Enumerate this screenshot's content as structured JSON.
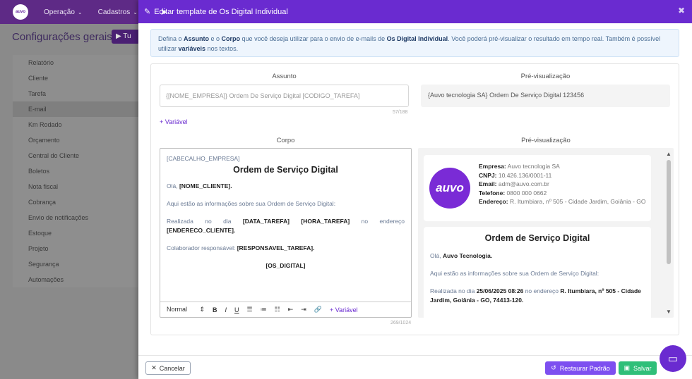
{
  "bg": {
    "nav": [
      "Operação",
      "Cadastros"
    ],
    "page_title": "Configurações gerais",
    "yt_button": "Tu",
    "sidebar": [
      "Relatório",
      "Cliente",
      "Tarefa",
      "E-mail",
      "Km Rodado",
      "Orçamento",
      "Central do Cliente",
      "Boletos",
      "Nota fiscal",
      "Cobrança",
      "Envio de notificações",
      "Estoque",
      "Projeto",
      "Segurança",
      "Automações"
    ]
  },
  "modal": {
    "title": "Editar template de Os Digital Individual",
    "info": {
      "p1": "Defina o ",
      "assunto": "Assunto",
      "p2": " e o ",
      "corpo": "Corpo",
      "p3": " que você deseja utilizar para o envio de e-mails de ",
      "osdigital": "Os Digital Individual",
      "p4": ". Você poderá pré-visualizar o resultado em tempo real. Também é possível utilizar ",
      "variaveis": "variáveis",
      "p5": " nos textos."
    },
    "subject": {
      "label": "Assunto",
      "value": "{[NOME_EMPRESA]} Ordem De Serviço Digital [CODIGO_TAREFA]",
      "counter": "57/188",
      "add_variable": "+ Variável",
      "preview_label": "Pré-visualização",
      "preview_value": "{Auvo tecnologia SA} Ordem De Serviço Digital 123456"
    },
    "body": {
      "label": "Corpo",
      "header_var": "[CABECALHO_EMPRESA]",
      "title": "Ordem de Serviço Digital",
      "greeting": "Olá, ",
      "client_var": "[NOME_CLIENTE].",
      "intro": "Aqui estão as informações sobre sua Ordem de Serviço Digital:",
      "done_1": "Realizada",
      "done_2": "no",
      "done_3": "dia",
      "date_var": "[DATA_TAREFA]",
      "hour_var": "[HORA_TAREFA]",
      "done_4": "no",
      "done_5": "endereço",
      "address_var": "[ENDERECO_CLIENTE].",
      "responsible": "Colaborador responsável: ",
      "responsible_var": "[RESPONSAVEL_TAREFA].",
      "os_var": "[OS_DIGITAL]",
      "toolbar": {
        "format": "Normal",
        "bold": "B",
        "italic": "I",
        "underline": "U",
        "add_variable": "+ Variável"
      },
      "counter": "269/1024"
    },
    "preview": {
      "label": "Pré-visualização",
      "logo_text": "auvo",
      "company_label": "Empresa:",
      "company": "Auvo tecnologia SA",
      "cnpj_label": "CNPJ:",
      "cnpj": "10.426.136/0001-11",
      "email_label": "Email:",
      "email": "adm@auvo.com.br",
      "phone_label": "Telefone:",
      "phone": "0800 000 0662",
      "address_label": "Endereço:",
      "address": "R. Itumbiara, nº 505 - Cidade Jardim, Goiânia - GO",
      "title": "Ordem de Serviço Digital",
      "greeting": "Olá, ",
      "client": "Auvo Tecnologia.",
      "intro": "Aqui estão as informações sobre sua Ordem de Serviço Digital:",
      "done_prefix": "Realizada no dia ",
      "datetime": "25/06/2025 08:26",
      "done_mid": " no endereço ",
      "full_address": "R. Itumbiara, nº 505 - Cidade Jardim, Goiânia - GO, 74413-120."
    },
    "footer": {
      "cancel": "Cancelar",
      "restore": "Restaurar Padrão",
      "save": "Salvar"
    }
  },
  "colors": {
    "header": "#6a2bd0",
    "restore": "#7d4ff0",
    "save": "#2fbf79"
  }
}
